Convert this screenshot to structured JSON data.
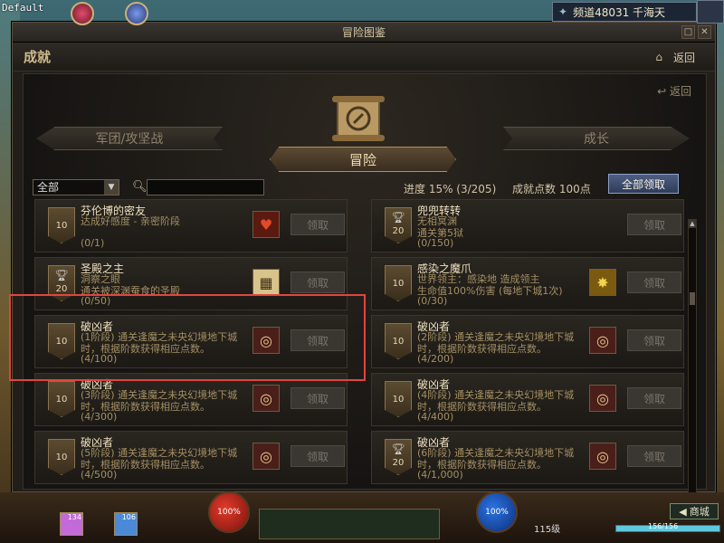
{
  "hud_top": {
    "version": "Default",
    "channel": "频道48031 千海天",
    "channel_icon": "channel-icon"
  },
  "window": {
    "title": "冒险图鉴",
    "breadcrumb": "成就",
    "home_icon": "home-icon",
    "back_label": "返回",
    "back_label_inner": "返回"
  },
  "tabs": {
    "left": "军团/攻坚战",
    "center": "冒险",
    "right": "成长"
  },
  "filter": {
    "selected": "全部"
  },
  "search": {
    "placeholder": ""
  },
  "stats": {
    "progress": "进度  15%  (3/205)",
    "points": "成就点数 100点"
  },
  "claim_all": "全部领取",
  "achievements": [
    {
      "name": "芬伦博的密友",
      "desc": "达成好感度 - 亲密阶段",
      "progress": "(0/1)",
      "points": "10",
      "trophy": false,
      "icon": "heart-icon",
      "icon_glyph": "♥",
      "claim": "领取"
    },
    {
      "name": "兜兜转转",
      "desc": "无相冥渊\n通关第5狱",
      "progress": "(0/150)",
      "points": "20",
      "trophy": true,
      "icon": "",
      "icon_glyph": "",
      "claim": "领取"
    },
    {
      "name": "圣殿之主",
      "desc": "洞察之眼\n通关被深渊蚕食的圣殿",
      "progress": "(0/50)",
      "points": "20",
      "trophy": true,
      "icon": "map-icon",
      "icon_glyph": "▦",
      "claim": "领取"
    },
    {
      "name": "感染之魔爪",
      "desc": "世界领主：感染地      造成领主\n生命值100%伤害 (每地下城1次)",
      "progress": "(0/30)",
      "points": "10",
      "trophy": false,
      "icon": "burst-icon",
      "icon_glyph": "✸",
      "claim": "领取"
    },
    {
      "name": "破凶者",
      "desc": "(1阶段) 通关逢魔之未央幻境地下城时，根据阶数获得相应点数。",
      "progress": "(4/100)",
      "points": "10",
      "trophy": false,
      "icon": "rune-icon",
      "icon_glyph": "◎",
      "claim": "领取"
    },
    {
      "name": "破凶者",
      "desc": "(2阶段) 通关逢魔之未央幻境地下城时，根据阶数获得相应点数。",
      "progress": "(4/200)",
      "points": "10",
      "trophy": false,
      "icon": "rune-icon",
      "icon_glyph": "◎",
      "claim": "领取"
    },
    {
      "name": "破凶者",
      "desc": "(3阶段) 通关逢魔之未央幻境地下城时，根据阶数获得相应点数。",
      "progress": "(4/300)",
      "points": "10",
      "trophy": false,
      "icon": "rune-icon",
      "icon_glyph": "◎",
      "claim": "领取"
    },
    {
      "name": "破凶者",
      "desc": "(4阶段) 通关逢魔之未央幻境地下城时，根据阶数获得相应点数。",
      "progress": "(4/400)",
      "points": "10",
      "trophy": false,
      "icon": "rune-icon",
      "icon_glyph": "◎",
      "claim": "领取"
    },
    {
      "name": "破凶者",
      "desc": "(5阶段) 通关逢魔之未央幻境地下城时，根据阶数获得相应点数。",
      "progress": "(4/500)",
      "points": "10",
      "trophy": false,
      "icon": "rune-icon",
      "icon_glyph": "◎",
      "claim": "领取"
    },
    {
      "name": "破凶者",
      "desc": "(6阶段) 通关逢魔之未央幻境地下城时，根据阶数获得相应点数。",
      "progress": "(4/1,000)",
      "points": "20",
      "trophy": true,
      "icon": "rune-icon",
      "icon_glyph": "◎",
      "claim": "领取"
    }
  ],
  "hud_bottom": {
    "hp": "100%",
    "mp": "100%",
    "level": "115级",
    "shop": "商城",
    "hp_numbers": "156/156",
    "hp_fill": 1.0,
    "inventory": [
      {
        "count": "134",
        "color": "#c46ad8"
      },
      {
        "count": "106",
        "color": "#4a8ad8"
      }
    ]
  }
}
